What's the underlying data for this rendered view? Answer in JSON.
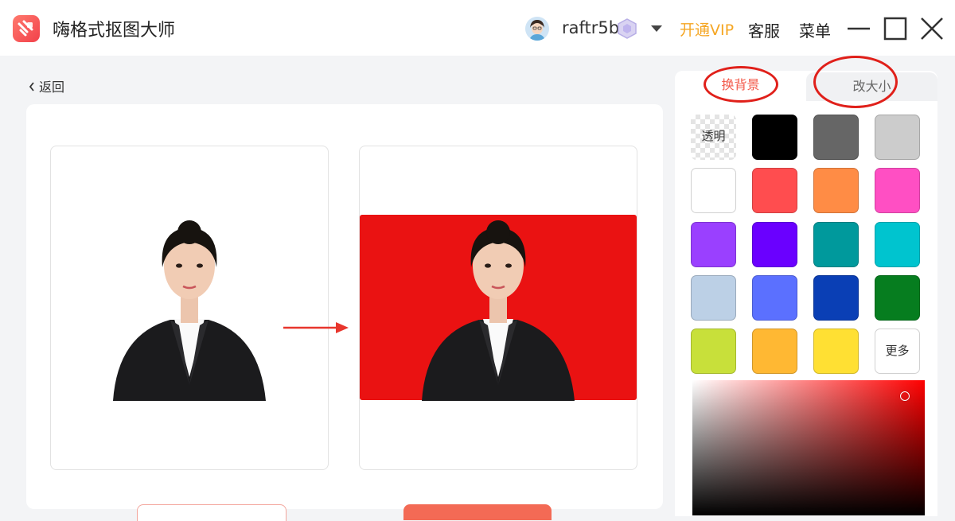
{
  "titlebar": {
    "app_title": "嗨格式抠图大师",
    "username": "raftr5b",
    "vip_label": "开通VIP",
    "service_label": "客服",
    "menu_label": "菜单"
  },
  "nav": {
    "back_label": "返回"
  },
  "tabs": {
    "change_bg_label": "换背景",
    "resize_label": "改大小",
    "active": "换背景"
  },
  "swatches": [
    {
      "label": "透明",
      "color": "transparent"
    },
    {
      "label": "",
      "color": "#000000"
    },
    {
      "label": "",
      "color": "#666666"
    },
    {
      "label": "",
      "color": "#cccccc"
    },
    {
      "label": "",
      "color": "#ffffff"
    },
    {
      "label": "",
      "color": "#ff4d4f"
    },
    {
      "label": "",
      "color": "#ff8c45"
    },
    {
      "label": "",
      "color": "#ff4fc3"
    },
    {
      "label": "",
      "color": "#9a40ff"
    },
    {
      "label": "",
      "color": "#6a00ff"
    },
    {
      "label": "",
      "color": "#00999c"
    },
    {
      "label": "",
      "color": "#00c4cf"
    },
    {
      "label": "",
      "color": "#bcd0e6"
    },
    {
      "label": "",
      "color": "#5b70ff"
    },
    {
      "label": "",
      "color": "#0a3fb5"
    },
    {
      "label": "",
      "color": "#067d1f"
    },
    {
      "label": "",
      "color": "#c8e03a"
    },
    {
      "label": "",
      "color": "#ffb833"
    },
    {
      "label": "",
      "color": "#ffe033"
    },
    {
      "label": "更多",
      "color": "#ffffff"
    }
  ],
  "colors": {
    "accent": "#f35a4a",
    "vip": "#f5a623",
    "result_background": "#ea1212",
    "picker_hue": "#ff0000"
  },
  "icons": {
    "logo": "app-logo-icon",
    "avatar": "user-avatar",
    "vip": "vip-gem-icon",
    "dropdown": "chevron-down-icon",
    "minimize": "minimize-icon",
    "maximize": "maximize-icon",
    "close": "close-icon",
    "back": "chevron-left-icon",
    "arrow": "arrow-right-icon"
  }
}
